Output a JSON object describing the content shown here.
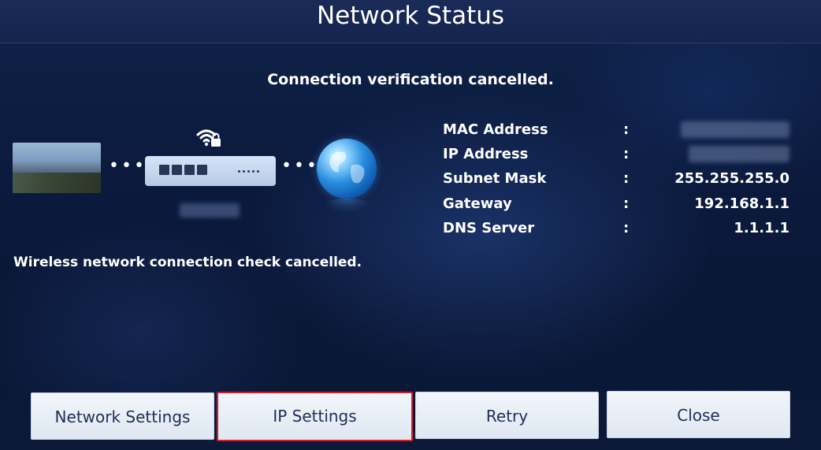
{
  "dialog": {
    "title": "Network Status",
    "status_message": "Connection verification cancelled.",
    "check_message": "Wireless network connection check cancelled."
  },
  "diagram": {
    "device_icon": "tv-thumbnail",
    "router_icon": "router-icon",
    "wifi_icon": "wifi-lock-icon",
    "internet_icon": "globe-icon",
    "connector_dots": "•••"
  },
  "network_info": [
    {
      "label": "MAC Address",
      "separator": ":",
      "value": "",
      "redacted": true
    },
    {
      "label": "IP Address",
      "separator": ":",
      "value": "",
      "redacted": true
    },
    {
      "label": "Subnet Mask",
      "separator": ":",
      "value": "255.255.255.0"
    },
    {
      "label": "Gateway",
      "separator": ":",
      "value": "192.168.1.1"
    },
    {
      "label": "DNS Server",
      "separator": ":",
      "value": "1.1.1.1"
    }
  ],
  "buttons": {
    "network_settings": "Network Settings",
    "ip_settings": "IP Settings",
    "retry": "Retry",
    "close": "Close",
    "focused": "ip_settings"
  },
  "colors": {
    "background": "#0b1a3d",
    "title_bar": "#1b2b58",
    "button_bg": "#e9eff7",
    "button_text": "#1d2e55",
    "focus_border": "#d0202c"
  }
}
